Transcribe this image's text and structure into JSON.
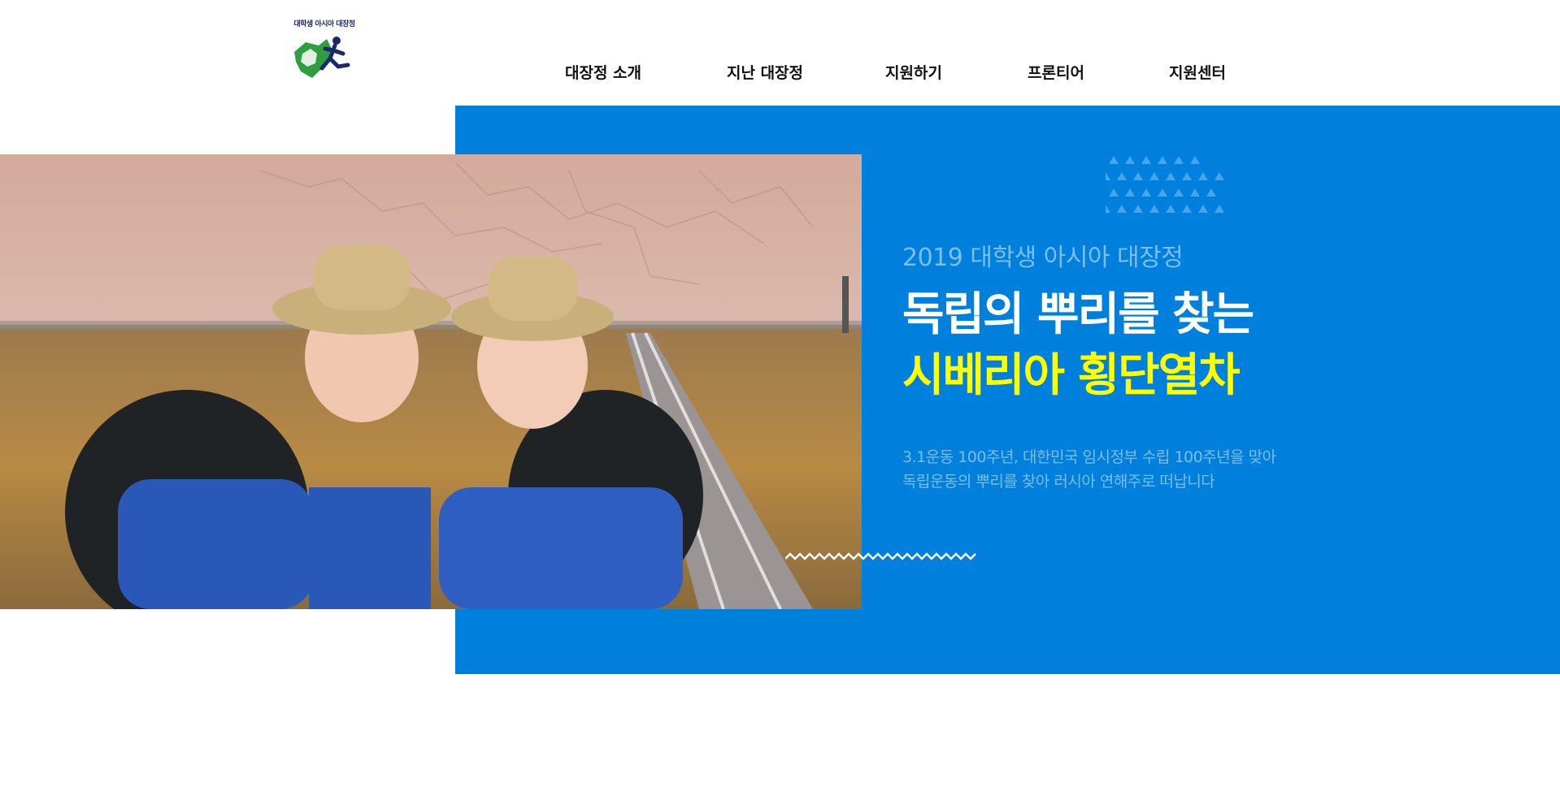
{
  "logo": {
    "text": "대학생 아시아 대장정",
    "icon": "runner-map-logo"
  },
  "nav": {
    "items": [
      {
        "label": "대장정 소개"
      },
      {
        "label": "지난 대장정"
      },
      {
        "label": "지원하기"
      },
      {
        "label": "프론티어"
      },
      {
        "label": "지원센터"
      }
    ]
  },
  "hero": {
    "subtitle": "2019 대학생 아시아 대장정",
    "title_line1": "독립의 뿌리를 찾는",
    "title_line2": "시베리아 횡단열차",
    "description_line1": "3.1운동 100주년, 대한민국 임시정부 수립 100주년을 맞아",
    "description_line2": "독립운동의 뿌리를 찾아 러시아 연해주로 떠납니다",
    "photo": "two-students-on-railway-photo"
  },
  "colors": {
    "panel_blue": "#0080dd",
    "title_white": "#ffffff",
    "title_yellow": "#ffff00",
    "muted_blue_text": "#7fbdf0"
  }
}
